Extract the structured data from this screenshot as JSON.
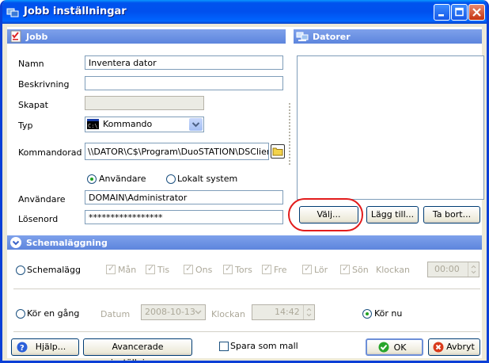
{
  "window": {
    "title": "Jobb inställningar"
  },
  "jobb": {
    "header": "Jobb",
    "name_label": "Namn",
    "name_value": "Inventera dator",
    "desc_label": "Beskrivning",
    "desc_value": "",
    "created_label": "Skapat",
    "created_value": "",
    "type_label": "Typ",
    "type_value": "Kommando",
    "command_label": "Kommandorad",
    "command_value": "\\\\DATOR\\C$\\Program\\DuoSTATION\\DSClient.E:",
    "radio_user": "Användare",
    "radio_local": "Lokalt system",
    "user_label": "Användare",
    "user_value": "DOMAIN\\Administrator",
    "password_label": "Lösenord",
    "password_value": "*****************"
  },
  "datorer": {
    "header": "Datorer",
    "choose_label": "Välj...",
    "add_label": "Lägg till...",
    "remove_label": "Ta bort..."
  },
  "schedule": {
    "header": "Schemaläggning",
    "schedule_radio": "Schemalägg",
    "days": [
      "Mån",
      "Tis",
      "Ons",
      "Tors",
      "Fre",
      "Lör",
      "Sön"
    ],
    "clock_label": "Klockan",
    "clock_value": "00:00",
    "run_once_radio": "Kör en gång",
    "date_label": "Datum",
    "date_value": "2008-10-13",
    "clock2_label": "Klockan",
    "clock2_value": "14:42",
    "run_now_radio": "Kör nu"
  },
  "footer": {
    "help_label": "Hjälp...",
    "advanced_label": "Avancerade inställningar",
    "save_template_label": "Spara som mall",
    "ok_label": "OK",
    "cancel_label": "Avbryt"
  },
  "colors": {
    "title_bar": "#0053ee",
    "panel_header": "#5d85dd",
    "highlight_oval": "#e21c1c"
  }
}
